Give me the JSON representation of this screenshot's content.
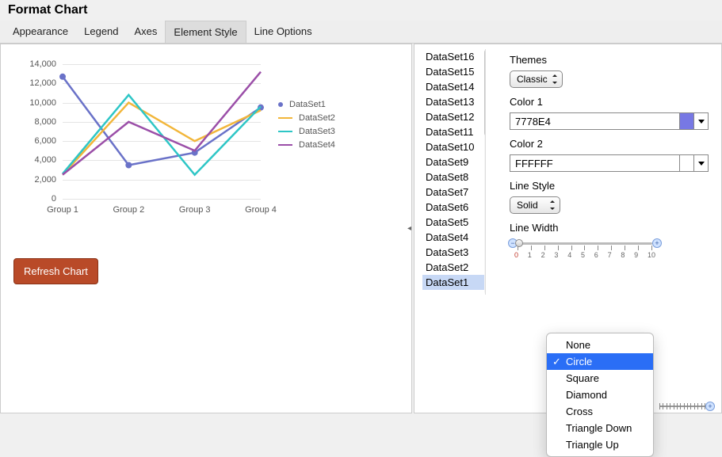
{
  "title": "Format Chart",
  "tabs": [
    "Appearance",
    "Legend",
    "Axes",
    "Element Style",
    "Line Options"
  ],
  "active_tab": 3,
  "refresh_label": "Refresh Chart",
  "datasets": [
    "DataSet1",
    "DataSet2",
    "DataSet3",
    "DataSet4",
    "DataSet5",
    "DataSet6",
    "DataSet7",
    "DataSet8",
    "DataSet9",
    "DataSet10",
    "DataSet11",
    "DataSet12",
    "DataSet13",
    "DataSet14",
    "DataSet15",
    "DataSet16"
  ],
  "selected_dataset": 0,
  "controls": {
    "themes_label": "Themes",
    "themes_value": "Classic",
    "color1_label": "Color 1",
    "color1_value": "7778E4",
    "color1_hex": "#7778E4",
    "color2_label": "Color 2",
    "color2_value": "FFFFFF",
    "color2_hex": "#FFFFFF",
    "linestyle_label": "Line Style",
    "linestyle_value": "Solid",
    "linewidth_label": "Line Width",
    "linewidth_value": 0,
    "linewidth_ticks": [
      "0",
      "1",
      "2",
      "3",
      "4",
      "5",
      "6",
      "7",
      "8",
      "9",
      "10"
    ]
  },
  "marker_popup": {
    "options": [
      "None",
      "Circle",
      "Square",
      "Diamond",
      "Cross",
      "Triangle Down",
      "Triangle Up"
    ],
    "selected": 1
  },
  "chart_data": {
    "type": "line",
    "categories": [
      "Group 1",
      "Group 2",
      "Group 3",
      "Group 4"
    ],
    "series": [
      {
        "name": "DataSet1",
        "color": "#6a72c8",
        "values": [
          12700,
          3500,
          4800,
          9500
        ]
      },
      {
        "name": "DataSet2",
        "color": "#f2b63a",
        "values": [
          2500,
          10000,
          6000,
          9200
        ]
      },
      {
        "name": "DataSet3",
        "color": "#2ec6c6",
        "values": [
          2600,
          10800,
          2500,
          9600
        ]
      },
      {
        "name": "DataSet4",
        "color": "#9b4fa8",
        "values": [
          2500,
          8000,
          5000,
          13200
        ]
      }
    ],
    "yticks": [
      0,
      2000,
      4000,
      6000,
      8000,
      10000,
      12000,
      14000
    ],
    "ylim": [
      0,
      14000
    ],
    "title": "",
    "xlabel": "",
    "ylabel": ""
  }
}
